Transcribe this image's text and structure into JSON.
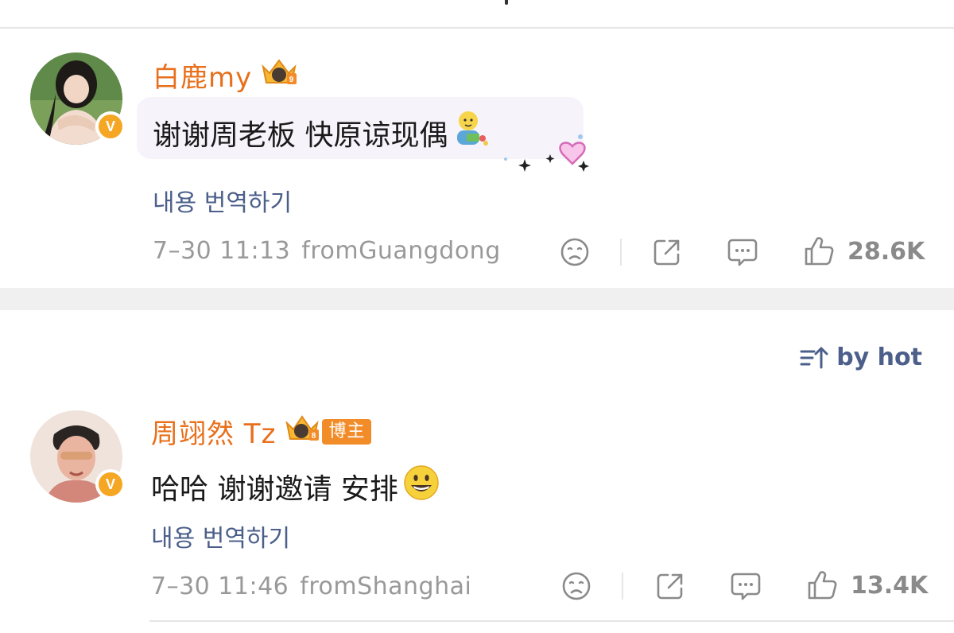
{
  "sort": {
    "label": "by hot",
    "icon": "sort-hot-icon"
  },
  "comments": [
    {
      "username": "白鹿my",
      "text": "谢谢周老板 快原谅现偶",
      "emoji": "baby-emoji",
      "translate_label": "내용 번역하기",
      "date": "7–30 11:13",
      "location": "fromGuangdong",
      "likes": "28.6K",
      "crown_level": "9"
    },
    {
      "username": "周翊然 Tz",
      "tag": "博主",
      "text": "哈哈 谢谢邀请 安排",
      "emoji": "grinning-face-emoji",
      "translate_label": "내용 번역하기",
      "date": "7–30 11:46",
      "location": "fromShanghai",
      "likes": "13.4K",
      "crown_level": "8"
    }
  ],
  "colors": {
    "username": "#e86f1b",
    "translate": "#4b5f8a",
    "meta": "#999999",
    "verified_badge": "#f5a623"
  }
}
